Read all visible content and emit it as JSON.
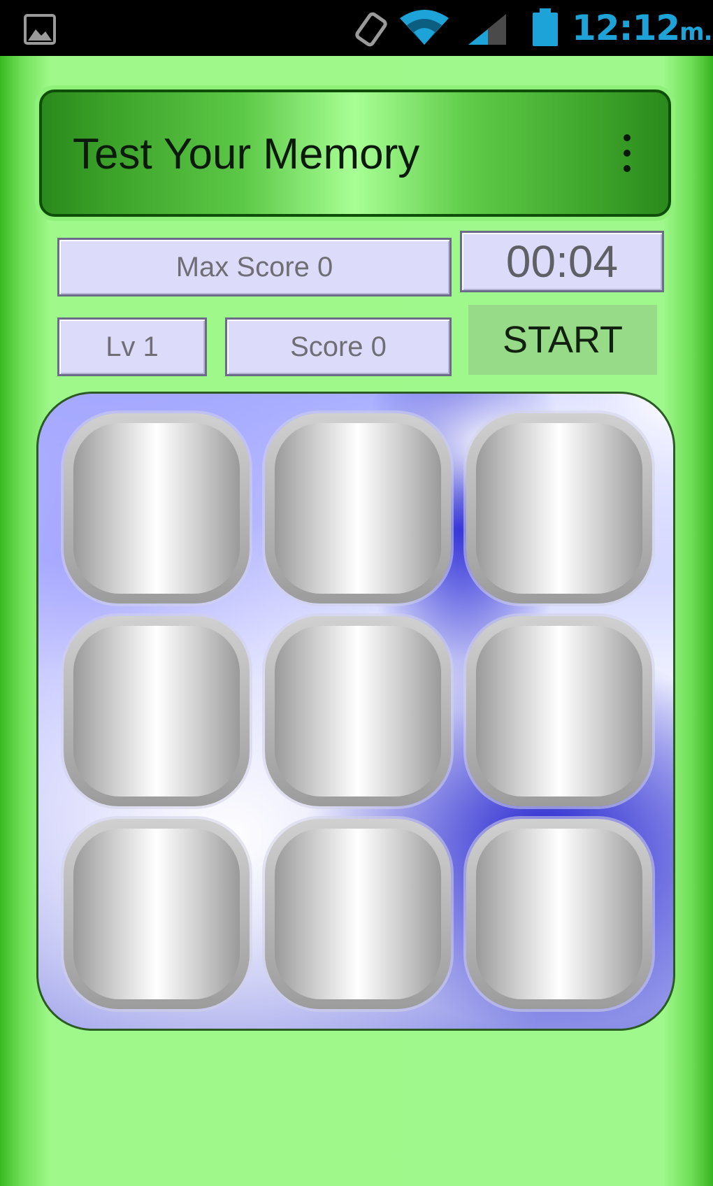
{
  "status_bar": {
    "time": "12:12",
    "suffix": "m.",
    "time_color": "#1ea3d8",
    "icons": [
      "gallery-icon",
      "screen-rotation-icon",
      "wifi-icon",
      "cell-signal-icon",
      "battery-icon"
    ]
  },
  "app": {
    "title": "Test Your Memory",
    "menu_icon": "more-vert-icon"
  },
  "stats": {
    "max_score": "Max Score  0",
    "timer": "00:04",
    "level": "Lv  1",
    "score": "Score  0"
  },
  "controls": {
    "start_label": "START"
  },
  "board": {
    "rows": 3,
    "columns": 3,
    "cells": [
      "",
      "",
      "",
      "",
      "",
      "",
      "",
      "",
      ""
    ]
  },
  "colors": {
    "background": "#a3ff8c",
    "titlebar": "#3ea52b",
    "info_box": "#dcdcfa",
    "start_button": "#97da87",
    "board": "#aab0ff"
  }
}
